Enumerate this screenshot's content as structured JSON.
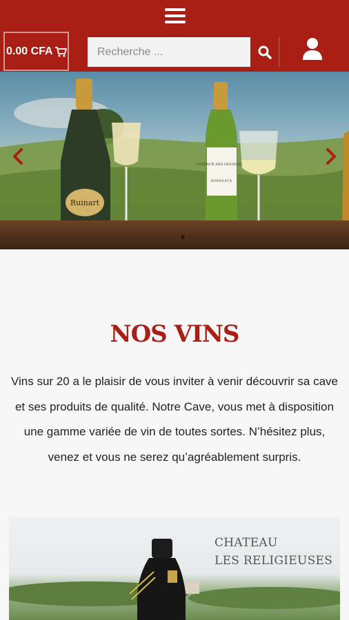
{
  "header": {
    "cart_label": "0.00 CFA",
    "search_placeholder": "Recherche ..."
  },
  "main": {
    "title": "NOS VINS",
    "description": "Vins sur 20 a le plaisir de vous inviter à venir découvrir sa cave et ses produits de qualité. Notre Cave, vous met à disposition une gamme variée de vin de toutes sortes. N’hésitez plus, venez et vous ne serez qu’agréablement surpris."
  },
  "slider": {
    "bottle1_label": "Ruinart",
    "bottle2_label": "COTEAUX DES GOUDONNE",
    "bottle2_sub": "BORDEAUX"
  },
  "promo": {
    "line1": "CHATEAU",
    "line2": "LES RELIGIEUSES"
  },
  "colors": {
    "brand": "#a91f16"
  },
  "icons": [
    "hamburger-menu-icon",
    "cart-icon",
    "search-icon",
    "user-icon",
    "chevron-left-icon",
    "chevron-right-icon"
  ]
}
